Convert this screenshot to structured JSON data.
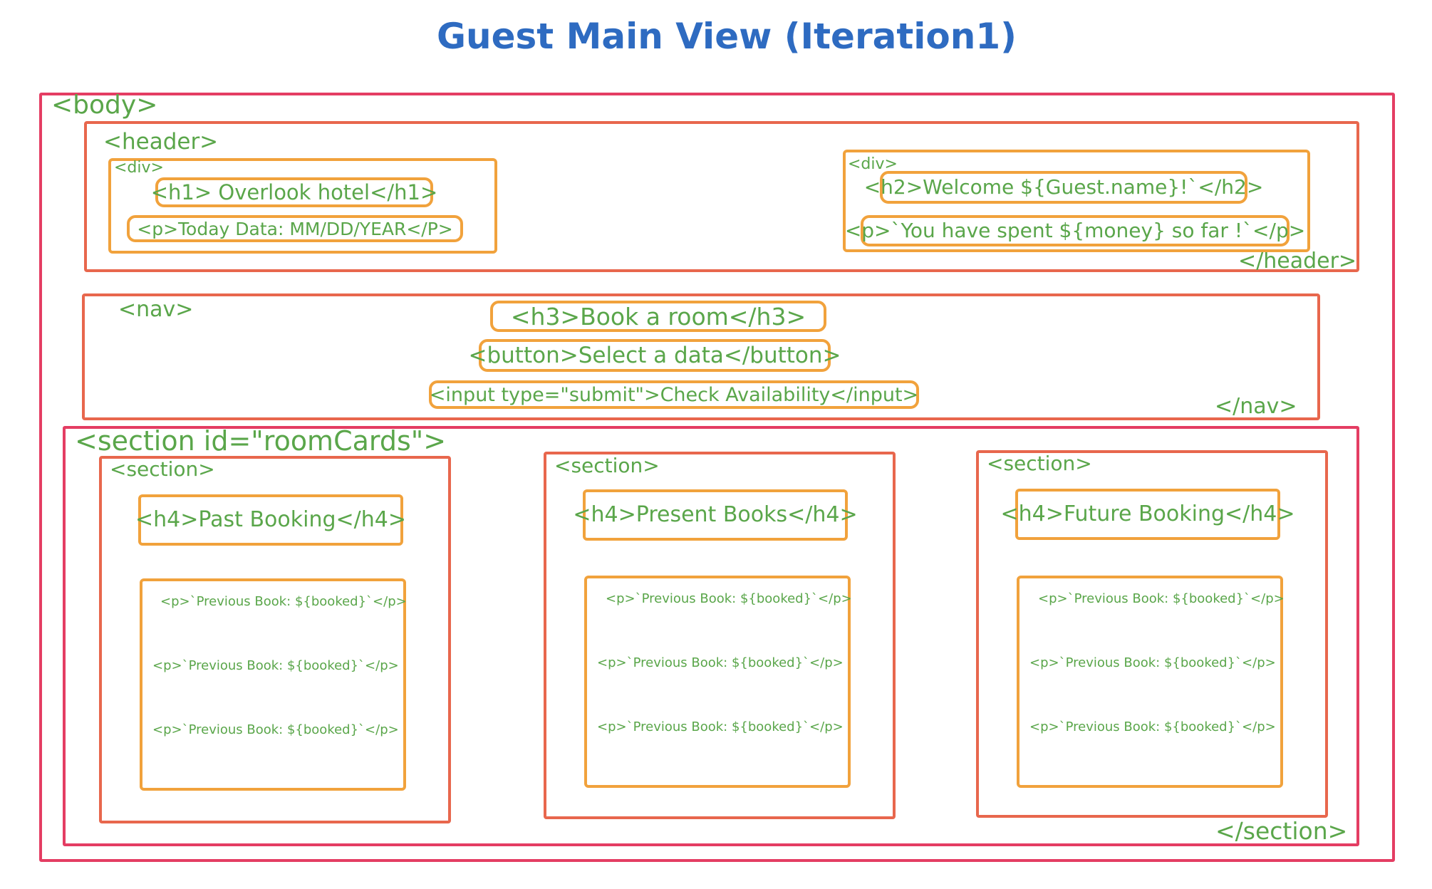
{
  "title": "Guest Main View (Iteration1)",
  "body": {
    "open": "<body>"
  },
  "header": {
    "open": "<header>",
    "close": "</header>",
    "left_div": {
      "tag": "<div>",
      "h1": "<h1> Overlook hotel</h1>",
      "p": "<p>Today Data: MM/DD/YEAR</P>"
    },
    "right_div": {
      "tag": "<div>",
      "h2": "<h2>Welcome ${Guest.name}!`</h2>",
      "p": "<p>`You have spent ${money} so far !`</p>"
    }
  },
  "nav": {
    "open": "<nav>",
    "close": "</nav>",
    "h3": "<h3>Book a room</h3>",
    "button": "<button>Select a data</button>",
    "input": "<input type=\"submit\">Check Availability</input>"
  },
  "room_cards": {
    "open": "<section id=\"roomCards\">",
    "close": "</section>",
    "sections": [
      {
        "tag": "<section>",
        "h4": "<h4>Past Booking</h4>",
        "items": [
          "<p>`Previous Book: ${booked}`</p>",
          "<p>`Previous Book: ${booked}`</p>",
          "<p>`Previous Book: ${booked}`</p>"
        ]
      },
      {
        "tag": "<section>",
        "h4": "<h4>Present Books</h4>",
        "items": [
          "<p>`Previous Book: ${booked}`</p>",
          "<p>`Previous Book: ${booked}`</p>",
          "<p>`Previous Book: ${booked}`</p>"
        ]
      },
      {
        "tag": "<section>",
        "h4": "<h4>Future Booking</h4>",
        "items": [
          "<p>`Previous Book: ${booked}`</p>",
          "<p>`Previous Book: ${booked}`</p>",
          "<p>`Previous Book: ${booked}`</p>"
        ]
      }
    ]
  }
}
